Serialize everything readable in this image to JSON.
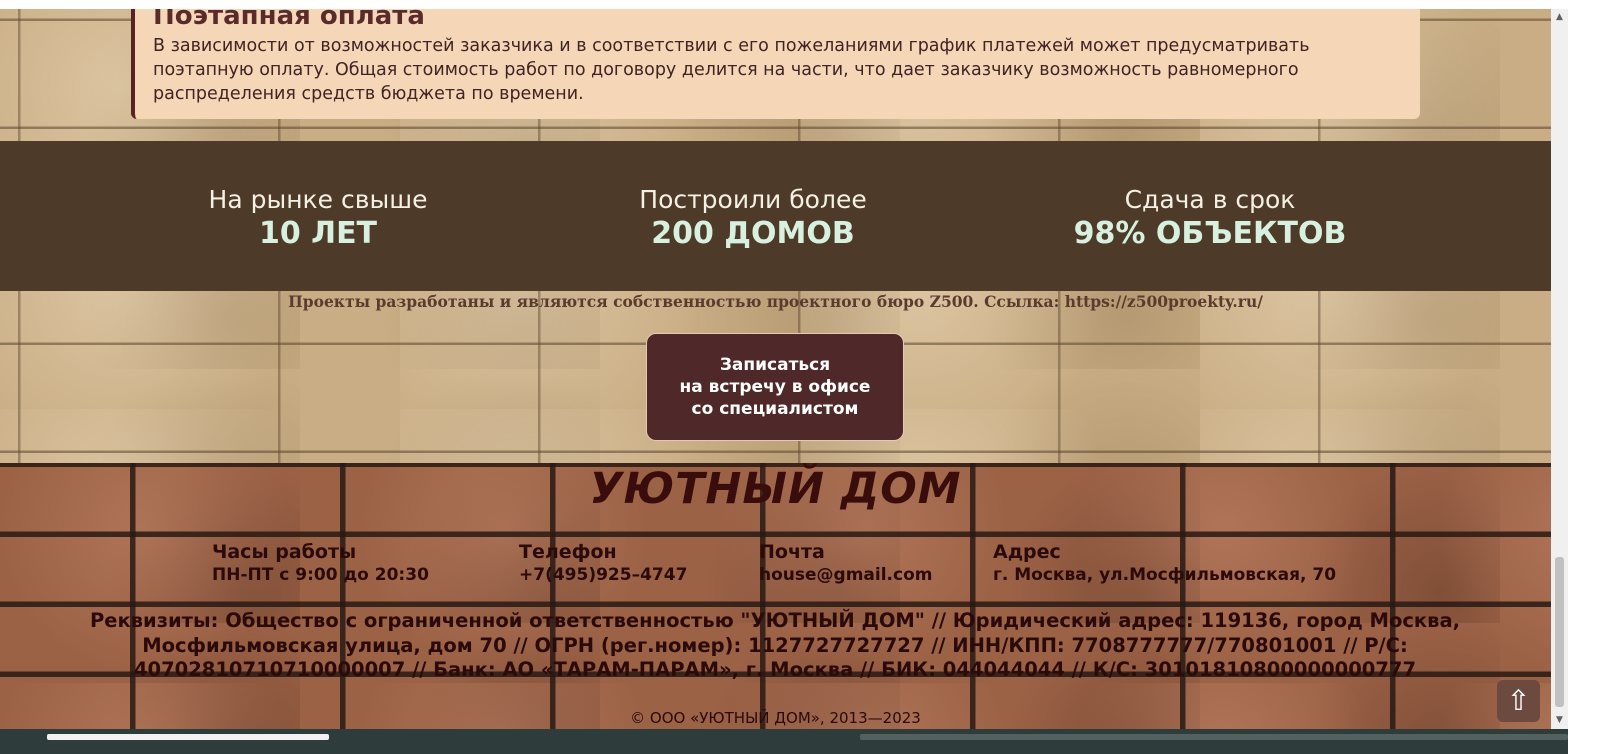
{
  "notice": {
    "title": "Поэтапная оплата",
    "text": "В зависимости от возможностей заказчика и в соответствии с его пожеланиями график платежей может предусматривать поэтапную оплату. Общая стоимость работ по договору делится на части, что дает заказчику возможность равномерного распределения средств бюджета по времени."
  },
  "stats": [
    {
      "top": "На рынке свыше",
      "big": "10 ЛЕТ"
    },
    {
      "top": "Построили более",
      "big": "200 ДОМОВ"
    },
    {
      "top": "Сдача в срок",
      "big": "98% ОБЪЕКТОВ"
    }
  ],
  "credit": "Проекты разработаны и являются собственностью проектного бюро Z500. Ссылка: https://z500proekty.ru/",
  "cta": {
    "line1": "Записаться",
    "line2": "на встречу в офисе",
    "line3": "со специалистом"
  },
  "footer": {
    "logo": "УЮТНЫЙ ДОМ",
    "hours": {
      "label": "Часы работы",
      "value": "ПН-ПТ с 9:00 до 20:30"
    },
    "phone": {
      "label": "Телефон",
      "value": "+7(495)925–4747"
    },
    "mail": {
      "label": "Почта",
      "value": "house@gmail.com"
    },
    "address": {
      "label": "Адрес",
      "value": "г. Москва, ул.Мосфильмовская, 70"
    },
    "requisites": "Реквизиты: Общество с ограниченной ответственностью \"УЮТНЫЙ ДОМ\" // Юридический адрес: 119136, город Москва, Мосфильмовская улица, дом 70 // ОГРН (рег.номер): 1127727727727 // ИНН/КПП: 7708777777/770801001 // Р/С: 40702810710710000007 // Банк: АО «ТАРАМ-ПАРАМ», г. Москва // БИК: 044044044 // К/С: 30101810800000000777",
    "copyright": "© ООО «УЮТНЫЙ ДОМ», 2013—2023"
  },
  "scroll_top_icon": "⇧"
}
